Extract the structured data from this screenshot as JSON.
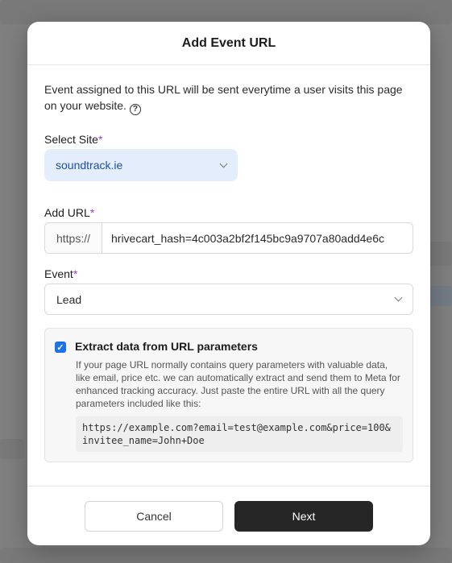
{
  "modal": {
    "title": "Add Event URL",
    "intro": "Event assigned to this URL will be sent everytime a user visits this page on your website."
  },
  "site": {
    "label": "Select Site",
    "required_mark": "*",
    "value": "soundtrack.ie"
  },
  "url": {
    "label": "Add URL",
    "required_mark": "*",
    "prefix": "https://",
    "value": "hrivecart_hash=4c003a2bf2f145bc9a9707a80add4e6c"
  },
  "event": {
    "label": "Event",
    "required_mark": "*",
    "value": "Lead"
  },
  "extract": {
    "checked": true,
    "title": "Extract data from URL parameters",
    "description": "If your page URL normally contains query parameters with valuable data, like email, price etc. we can automatically extract and send them to Meta for enhanced tracking accuracy. Just paste the entire URL with all the query parameters included like this:",
    "example": "https://example.com?email=test@example.com&price=100&invitee_name=John+Doe"
  },
  "footer": {
    "cancel_label": "Cancel",
    "next_label": "Next"
  },
  "colors": {
    "accent": "#9b3bd9",
    "select_bg": "#e3edfb",
    "select_text": "#1f4fa8",
    "checkbox": "#1a73e8",
    "primary_button": "#262626"
  }
}
